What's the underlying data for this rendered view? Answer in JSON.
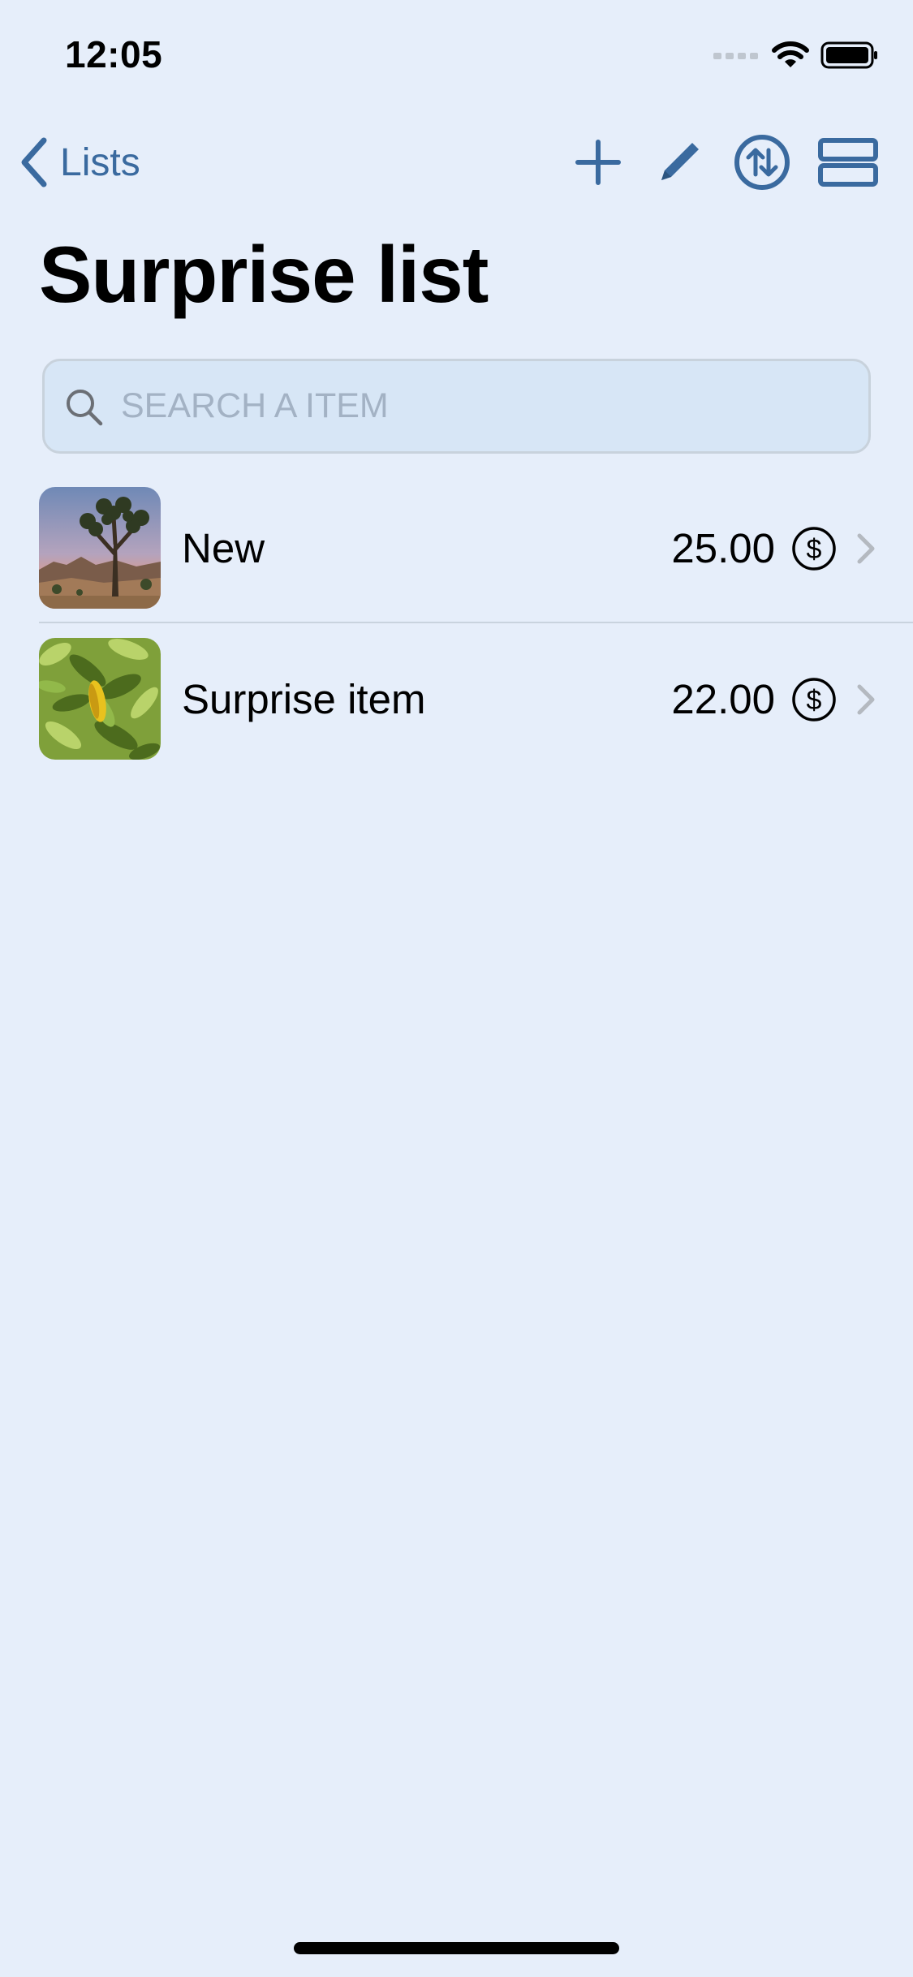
{
  "status_bar": {
    "time": "12:05"
  },
  "nav": {
    "back_label": "Lists"
  },
  "page": {
    "title": "Surprise list"
  },
  "search": {
    "placeholder": "SEARCH A ITEM",
    "value": ""
  },
  "items": [
    {
      "label": "New",
      "price": "25.00",
      "image": "joshua-tree-desert-photo"
    },
    {
      "label": "Surprise item",
      "price": "22.00",
      "image": "green-leaves-photo"
    }
  ],
  "colors": {
    "background": "#e6eefa",
    "accent": "#3a6a9f",
    "search_bg": "#d7e6f6"
  },
  "icons": {
    "back": "chevron-left-icon",
    "add": "plus-icon",
    "edit": "pencil-icon",
    "sort": "sort-arrows-circle-icon",
    "layout": "layout-rows-icon",
    "search": "magnifier-icon",
    "currency": "dollar-circle-icon",
    "disclosure": "chevron-right-icon"
  }
}
